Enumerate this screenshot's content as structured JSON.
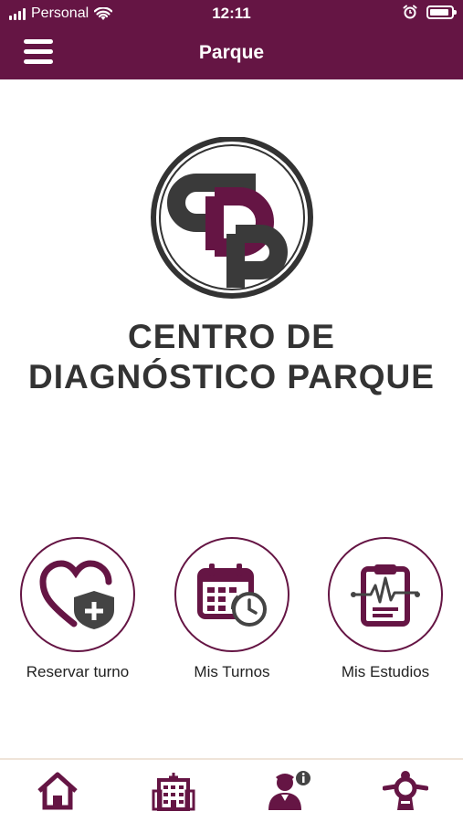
{
  "status_bar": {
    "carrier": "Personal",
    "time": "12:11"
  },
  "header": {
    "title": "Parque",
    "menu_icon": "hamburger-menu-icon"
  },
  "logo": {
    "monogram": "CDP",
    "line1": "CENTRO DE",
    "line2": "DIAGNÓSTICO PARQUE"
  },
  "actions": [
    {
      "label": "Reservar turno",
      "icon": "heart-shield-plus-icon"
    },
    {
      "label": "Mis Turnos",
      "icon": "calendar-clock-icon"
    },
    {
      "label": "Mis Estudios",
      "icon": "clipboard-heartbeat-icon"
    }
  ],
  "bottom_nav": [
    {
      "icon": "home-icon"
    },
    {
      "icon": "hospital-building-icon"
    },
    {
      "icon": "doctor-info-icon"
    },
    {
      "icon": "lifebuoy-support-icon"
    }
  ],
  "colors": {
    "brand": "#651544",
    "dark_gray": "#333333",
    "divider": "#efe4d8"
  }
}
